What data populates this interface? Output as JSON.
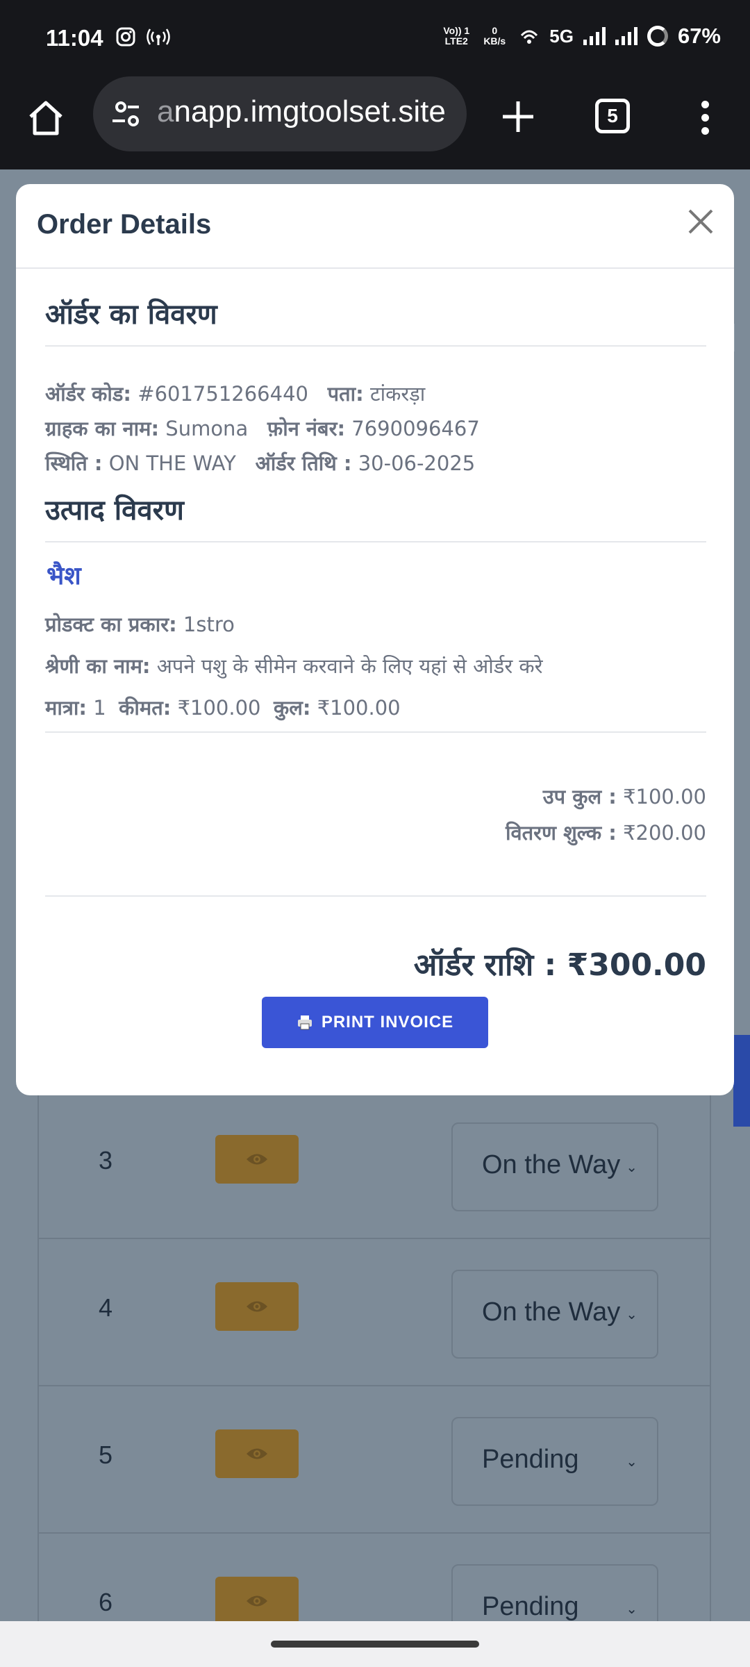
{
  "status_bar": {
    "time": "11:04",
    "volte": "Vo)) 1 LTE2",
    "speed": "0 KB/s",
    "network": "5G",
    "battery": "67%",
    "icons": [
      "instagram-icon",
      "hotspot-icon",
      "wifi-calling-icon",
      "signal-icon",
      "signal-icon",
      "battery-icon"
    ]
  },
  "browser": {
    "url_faded": "a",
    "url": "napp.imgtoolset.site",
    "tab_count": "5"
  },
  "modal": {
    "title": "Order Details",
    "order_heading": "ऑर्डर का विवरण",
    "order_code_label": "ऑर्डर कोड:",
    "order_code": "#601751266440",
    "address_label": "पता:",
    "address": "टांकरड़ा",
    "customer_label": "ग्राहक का नाम:",
    "customer": "Sumona",
    "phone_label": "फ़ोन नंबर:",
    "phone": "7690096467",
    "status_label": "स्थिति :",
    "status": "ON THE WAY",
    "date_label": "ऑर्डर तिथि :",
    "date": "30-06-2025",
    "product_heading": "उत्पाद विवरण",
    "product": {
      "name": "भैश",
      "type_label": "प्रोडक्ट का प्रकार:",
      "type": "1stro",
      "category_label": "श्रेणी का नाम:",
      "category": "अपने पशु के सीमेन करवाने के लिए यहां से ओर्डर करे",
      "qty_label": "मात्रा:",
      "qty": "1",
      "price_label": "कीमत:",
      "price": "₹100.00",
      "line_total_label": "कुल:",
      "line_total": "₹100.00"
    },
    "subtotal_label": "उप कुल :",
    "subtotal": "₹100.00",
    "delivery_label": "वितरण शुल्क :",
    "delivery": "₹200.00",
    "total_label": "ऑर्डर राशि :",
    "total": "₹300.00",
    "print_button": "PRINT INVOICE",
    "accent_color": "#3a55d6"
  },
  "background_table": {
    "rows": [
      {
        "num": "3",
        "status": "On the Way"
      },
      {
        "num": "4",
        "status": "On the Way"
      },
      {
        "num": "5",
        "status": "Pending"
      },
      {
        "num": "6",
        "status": "Pending"
      }
    ],
    "view_button_color": "#8a6a2d"
  }
}
